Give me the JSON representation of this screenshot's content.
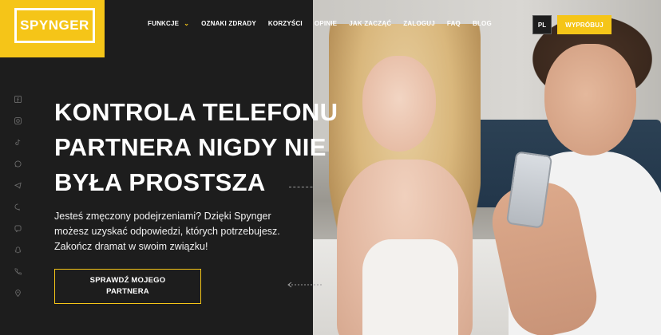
{
  "brand": {
    "logo_text": "SPYNGER",
    "accent": "#f5c518"
  },
  "nav": {
    "items": [
      {
        "label": "FUNKCJE",
        "has_dropdown": true
      },
      {
        "label": "OZNAKI ZDRADY"
      },
      {
        "label": "KORZYŚCI"
      },
      {
        "label": "OPINIE"
      },
      {
        "label": "JAK ZACZĄĆ"
      },
      {
        "label": "ZALOGUJ"
      },
      {
        "label": "FAQ"
      },
      {
        "label": "BLOG"
      }
    ],
    "language": "PL",
    "try_button": "WYPRÓBUJ"
  },
  "hero": {
    "title_lines": [
      "KONTROLA TELEFONU",
      "PARTNERA NIGDY NIE",
      "BYŁA PROSTSZA"
    ],
    "subtitle": "Jesteś zmęczony podejrzeniami? Dzięki Spynger możesz uzyskać odpowiedzi, których potrzebujesz. Zakończ dramat w swoim związku!",
    "cta_label": "SPRAWDŹ MOJEGO PARTNERA"
  },
  "socials": [
    "facebook-icon",
    "instagram-icon",
    "tiktok-icon",
    "whatsapp-icon",
    "telegram-icon",
    "messenger-icon",
    "viber-icon",
    "snapchat-icon",
    "phone-icon",
    "location-icon"
  ]
}
